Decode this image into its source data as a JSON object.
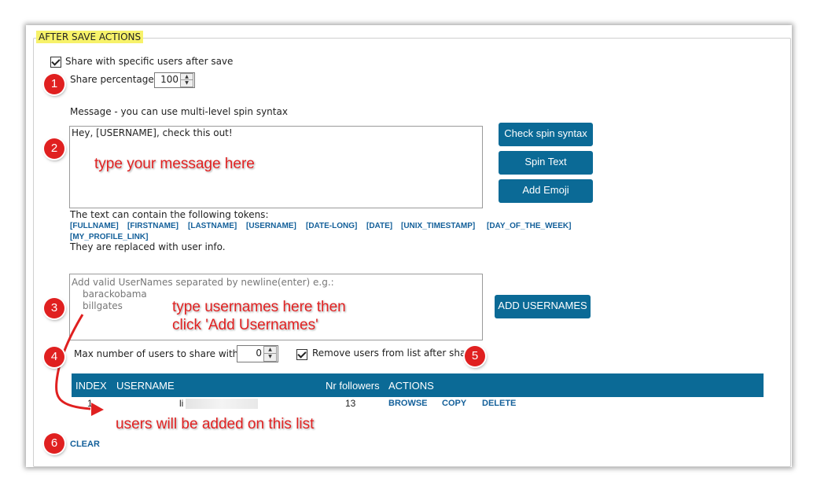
{
  "group_title": "AFTER SAVE ACTIONS",
  "share_checkbox": {
    "label": "Share with specific users after save",
    "checked": true
  },
  "share_percentage": {
    "label": "Share percentage",
    "value": "100"
  },
  "message": {
    "label": "Message - you can use multi-level spin syntax",
    "value": "Hey, [USERNAME], check this out!"
  },
  "buttons": {
    "check_spin": "Check spin syntax",
    "spin_text": "Spin Text",
    "add_emoji": "Add Emoji",
    "add_usernames": "ADD USERNAMES"
  },
  "tokens": {
    "intro": "The text can contain the following tokens:",
    "list": [
      "[FULLNAME]",
      "[FIRSTNAME]",
      "[LASTNAME]",
      "[USERNAME]",
      "[DATE-LONG]",
      "[DATE]",
      "[UNIX_TIMESTAMP]",
      "[DAY_OF_THE_WEEK]",
      "[MY_PROFILE_LINK]"
    ],
    "outro": "They are replaced with user info."
  },
  "usernames": {
    "placeholder_line1": "Add valid UserNames separated by newline(enter) e.g.:",
    "placeholder_line2": "barackobama",
    "placeholder_line3": "billgates"
  },
  "max_users": {
    "label": "Max number of users to share with",
    "value": "0"
  },
  "remove_checkbox": {
    "label": "Remove users from list after share",
    "checked": true
  },
  "table": {
    "headers": [
      "INDEX",
      "USERNAME",
      "Nr followers",
      "ACTIONS"
    ],
    "rows": [
      {
        "index": "1",
        "username": "li",
        "followers": "13",
        "actions": [
          "BROWSE",
          "COPY",
          "DELETE"
        ]
      }
    ]
  },
  "clear_link": "CLEAR",
  "annotations": {
    "badges": [
      "1",
      "2",
      "3",
      "4",
      "5",
      "6"
    ],
    "message_hint": "type your message here",
    "usernames_hint_line1": "type usernames here then",
    "usernames_hint_line2": "click 'Add Usernames'",
    "list_hint": "users will be added on this list"
  },
  "colors": {
    "accent": "#0b6a96",
    "annotation": "#e02020",
    "legend_highlight": "#f7f26a"
  }
}
